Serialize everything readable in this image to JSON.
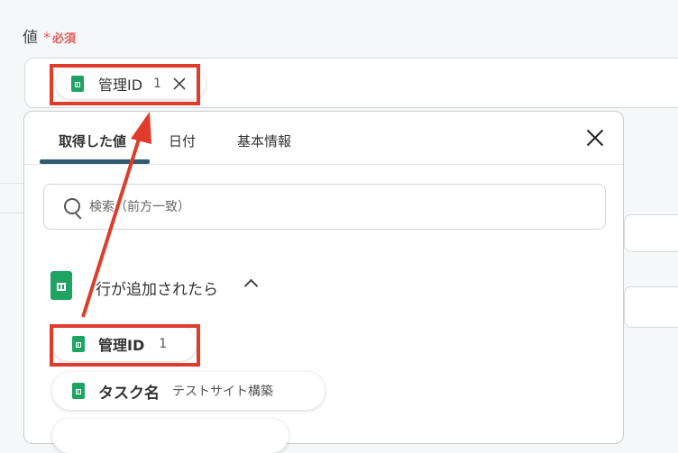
{
  "field": {
    "label": "値",
    "required_mark": "*",
    "required_text": "必須"
  },
  "selected_chip": {
    "name": "管理ID",
    "count": "1"
  },
  "panel": {
    "tabs": [
      {
        "label": "取得した値",
        "active": true
      },
      {
        "label": "日付",
        "active": false
      },
      {
        "label": "基本情報",
        "active": false
      }
    ],
    "search": {
      "placeholder": "検索（前方一致）",
      "value": ""
    },
    "section": {
      "title": "行が追加されたら",
      "expanded": true
    },
    "items": [
      {
        "name": "管理ID",
        "value": "1"
      },
      {
        "name": "タスク名",
        "value": "テストサイト構築"
      }
    ]
  },
  "colors": {
    "accent": "#2f5b6e",
    "highlight": "#e03c2b",
    "sheet_green": "#1ea362",
    "required": "#e35b5b"
  }
}
